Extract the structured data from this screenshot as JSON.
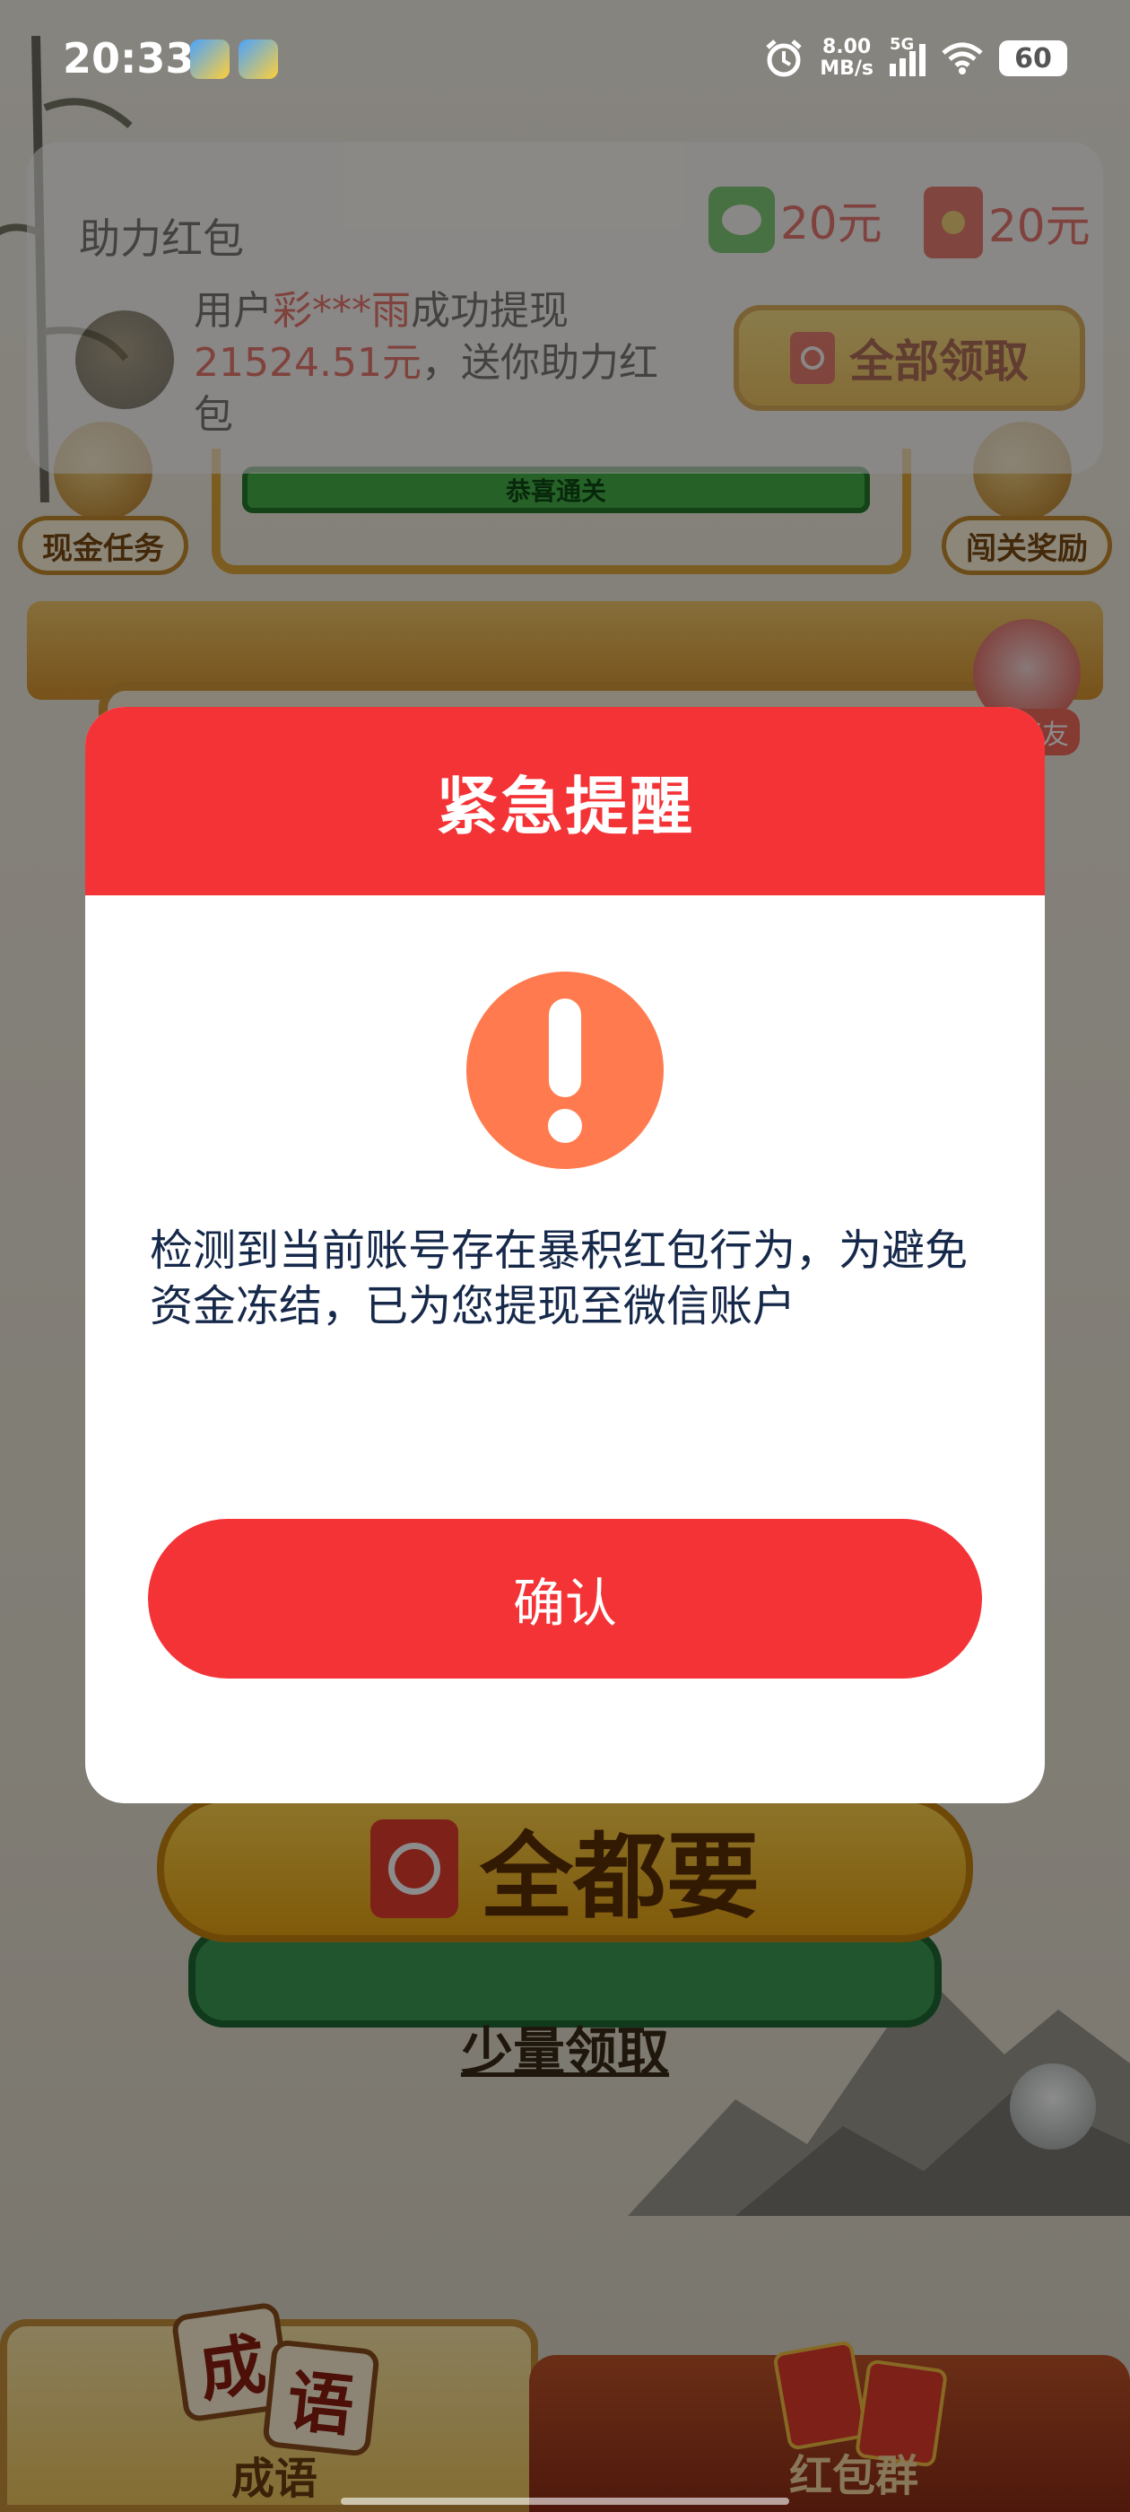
{
  "status_bar": {
    "time": "20:33",
    "speed_value": "8.00",
    "speed_unit": "MB/s",
    "network": "5G",
    "battery": "60"
  },
  "notification": {
    "title": "助力红包",
    "reward_wechat": "20元",
    "reward_redpacket": "20元",
    "message_prefix": "用户",
    "user_masked": "彩***雨",
    "message_mid": "成功提现",
    "amount": "21524.51元",
    "message_suffix": "，送你助力红包",
    "claim_button": "全部领取"
  },
  "background": {
    "task_left": "现金任务",
    "task_right": "闯关奖励",
    "congrats": "恭喜通关",
    "friend_label": "好友",
    "all_want_button": "全都要",
    "small_claim_link": "少量领取",
    "tabs": [
      {
        "label": "成语",
        "tile1": "成",
        "tile2": "语"
      },
      {
        "label": "红包群"
      }
    ]
  },
  "modal": {
    "title": "紧急提醒",
    "message": "检测到当前账号存在暴积红包行为，为避免资金冻结，已为您提现至微信账户",
    "confirm_button": "确认"
  },
  "colors": {
    "modal_red": "#f43337",
    "alert_orange": "#ff7b4f",
    "body_text": "#16294a"
  }
}
